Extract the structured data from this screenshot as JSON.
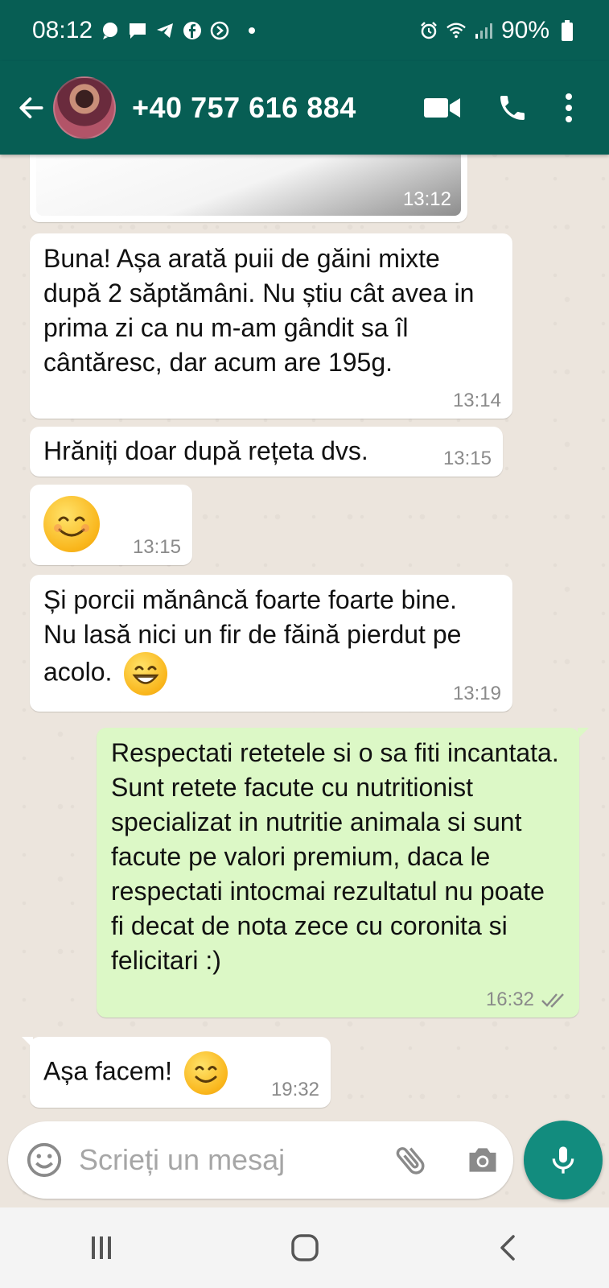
{
  "status_bar": {
    "time": "08:12",
    "battery": "90%",
    "icons": [
      "chat-bubble-icon",
      "message-icon",
      "telegram-icon",
      "facebook-icon",
      "signal-icon",
      "alarm-icon",
      "wifi-icon",
      "cell-signal-icon",
      "battery-icon"
    ]
  },
  "header": {
    "contact_name": "+40 757 616 884",
    "icons": [
      "back-arrow-icon",
      "video-call-icon",
      "phone-icon",
      "more-vert-icon"
    ]
  },
  "messages": [
    {
      "type": "image",
      "time": "13:12"
    },
    {
      "type": "text",
      "text": "Buna! Așa arată puii de găini mixte după 2 săptămâni. Nu știu cât avea in prima zi ca nu m-am gândit sa îl cântăresc, dar acum are 195g.",
      "time": "13:14"
    },
    {
      "type": "text",
      "text": "Hrăniți doar după rețeta dvs.",
      "time": "13:15"
    },
    {
      "type": "emoji",
      "emoji": "smiling-face-icon",
      "time": "13:15"
    },
    {
      "type": "text",
      "text": "Și porcii mănâncă foarte foarte bine. Nu lasă nici un fir de făină pierdut pe acolo.",
      "emoji": "grinning-face-icon",
      "time": "13:19"
    },
    {
      "type": "text",
      "direction": "outgoing",
      "text": "Respectati retetele si o sa fiti incantata. Sunt retete facute cu nutritionist specializat in nutritie animala si sunt facute pe valori premium, daca le respectati intocmai rezultatul nu poate fi decat de nota zece cu coronita si felicitari :)",
      "time": "16:32",
      "status": "read"
    },
    {
      "type": "text",
      "text": "Așa facem!",
      "emoji": "smiling-face-icon",
      "time": "19:32"
    }
  ],
  "composer": {
    "placeholder": "Scrieți un mesaj",
    "icons": [
      "emoji-icon",
      "attach-icon",
      "camera-icon",
      "mic-icon"
    ]
  },
  "colors": {
    "header": "#075e54",
    "chat_background": "#ece5dd",
    "outgoing_bubble": "#dcf8c6",
    "incoming_bubble": "#ffffff",
    "mic_button": "#128c7e"
  }
}
